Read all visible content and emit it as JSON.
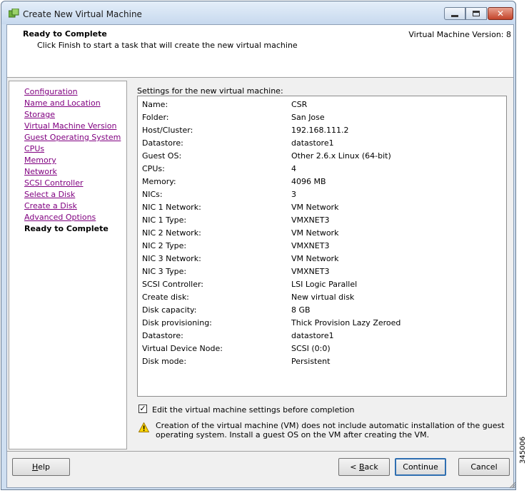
{
  "window": {
    "title": "Create New Virtual Machine"
  },
  "header": {
    "title": "Ready to Complete",
    "subtitle": "Click Finish to start a task that will create the new virtual machine",
    "version": "Virtual Machine Version: 8"
  },
  "nav": {
    "items": [
      {
        "label": "Configuration"
      },
      {
        "label": "Name and Location"
      },
      {
        "label": "Storage"
      },
      {
        "label": "Virtual Machine Version"
      },
      {
        "label": "Guest Operating System"
      },
      {
        "label": "CPUs"
      },
      {
        "label": "Memory"
      },
      {
        "label": "Network"
      },
      {
        "label": "SCSI Controller"
      },
      {
        "label": "Select a Disk"
      },
      {
        "label": "Create a Disk"
      },
      {
        "label": "Advanced Options"
      },
      {
        "label": "Ready to Complete"
      }
    ]
  },
  "settings": {
    "label": "Settings for the new virtual machine:",
    "rows": [
      {
        "name": "Name:",
        "value": "CSR"
      },
      {
        "name": "Folder:",
        "value": "San Jose"
      },
      {
        "name": "Host/Cluster:",
        "value": "192.168.111.2"
      },
      {
        "name": "Datastore:",
        "value": "datastore1"
      },
      {
        "name": "Guest OS:",
        "value": "Other 2.6.x Linux (64-bit)"
      },
      {
        "name": "CPUs:",
        "value": "4"
      },
      {
        "name": "Memory:",
        "value": "4096 MB"
      },
      {
        "name": "NICs:",
        "value": "3"
      },
      {
        "name": "NIC 1 Network:",
        "value": "VM Network"
      },
      {
        "name": "NIC 1 Type:",
        "value": "VMXNET3"
      },
      {
        "name": "NIC 2 Network:",
        "value": "VM Network"
      },
      {
        "name": "NIC 2 Type:",
        "value": "VMXNET3"
      },
      {
        "name": "NIC 3 Network:",
        "value": "VM Network"
      },
      {
        "name": "NIC 3 Type:",
        "value": "VMXNET3"
      },
      {
        "name": "SCSI Controller:",
        "value": "LSI Logic Parallel"
      },
      {
        "name": "Create disk:",
        "value": "New virtual disk"
      },
      {
        "name": "Disk capacity:",
        "value": "8 GB"
      },
      {
        "name": "Disk provisioning:",
        "value": "Thick Provision Lazy Zeroed"
      },
      {
        "name": "Datastore:",
        "value": "datastore1"
      },
      {
        "name": "Virtual Device Node:",
        "value": "SCSI (0:0)"
      },
      {
        "name": "Disk mode:",
        "value": "Persistent"
      }
    ]
  },
  "edit_checkbox": {
    "label": "Edit the virtual machine settings before completion",
    "checked": true
  },
  "warning": {
    "text": "Creation of the virtual machine (VM) does not include automatic installation of the guest operating system. Install a guest OS on the VM after creating the VM."
  },
  "buttons": {
    "help": {
      "mnemonic": "H",
      "rest": "elp"
    },
    "back": {
      "prefix": "< ",
      "mnemonic": "B",
      "rest": "ack"
    },
    "continue": "Continue",
    "cancel": "Cancel"
  },
  "figure_id": "345006"
}
